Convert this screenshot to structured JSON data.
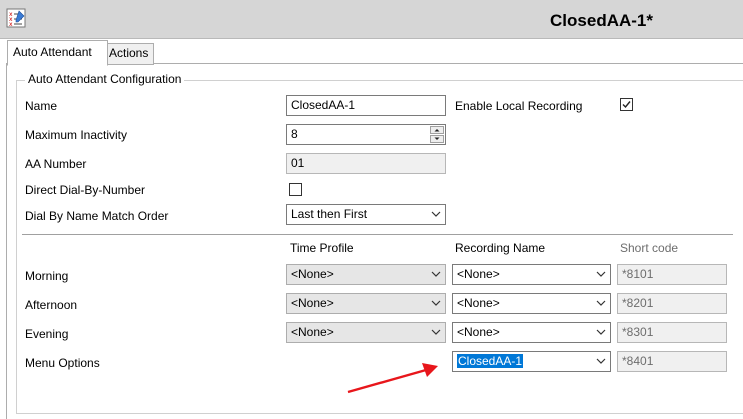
{
  "window": {
    "title": "ClosedAA-1*"
  },
  "tabs": [
    {
      "label": "Auto Attendant"
    },
    {
      "label": "Actions"
    }
  ],
  "config": {
    "group_label": "Auto Attendant Configuration",
    "name": {
      "label": "Name",
      "value": "ClosedAA-1"
    },
    "enable_local_recording": {
      "label": "Enable Local Recording",
      "checked": true
    },
    "maximum_inactivity": {
      "label": "Maximum Inactivity",
      "value": "8"
    },
    "aa_number": {
      "label": "AA Number",
      "value": "01"
    },
    "direct_dial": {
      "label": "Direct Dial-By-Number",
      "checked": false
    },
    "dial_by_name": {
      "label": "Dial By Name Match Order",
      "value": "Last then First"
    }
  },
  "table": {
    "headers": {
      "time_profile": "Time Profile",
      "recording_name": "Recording Name",
      "short_code": "Short code"
    },
    "rows": [
      {
        "label": "Morning",
        "time_profile": "<None>",
        "recording": "<None>",
        "short_code": "*8101"
      },
      {
        "label": "Afternoon",
        "time_profile": "<None>",
        "recording": "<None>",
        "short_code": "*8201"
      },
      {
        "label": "Evening",
        "time_profile": "<None>",
        "recording": "<None>",
        "short_code": "*8301"
      },
      {
        "label": "Menu Options",
        "time_profile": "",
        "recording": "ClosedAA-1",
        "short_code": "*8401"
      }
    ]
  },
  "annotation": {
    "arrow_color": "#e8161b"
  }
}
